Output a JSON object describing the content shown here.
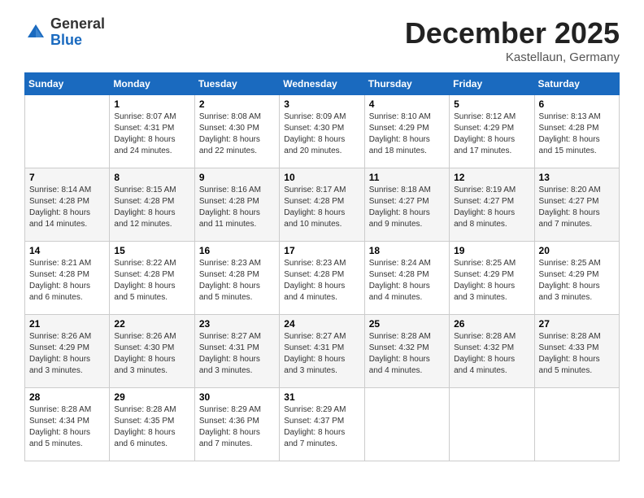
{
  "header": {
    "logo_general": "General",
    "logo_blue": "Blue",
    "month_title": "December 2025",
    "subtitle": "Kastellaun, Germany"
  },
  "calendar": {
    "days_of_week": [
      "Sunday",
      "Monday",
      "Tuesday",
      "Wednesday",
      "Thursday",
      "Friday",
      "Saturday"
    ],
    "weeks": [
      [
        {
          "day": "",
          "info": ""
        },
        {
          "day": "1",
          "info": "Sunrise: 8:07 AM\nSunset: 4:31 PM\nDaylight: 8 hours\nand 24 minutes."
        },
        {
          "day": "2",
          "info": "Sunrise: 8:08 AM\nSunset: 4:30 PM\nDaylight: 8 hours\nand 22 minutes."
        },
        {
          "day": "3",
          "info": "Sunrise: 8:09 AM\nSunset: 4:30 PM\nDaylight: 8 hours\nand 20 minutes."
        },
        {
          "day": "4",
          "info": "Sunrise: 8:10 AM\nSunset: 4:29 PM\nDaylight: 8 hours\nand 18 minutes."
        },
        {
          "day": "5",
          "info": "Sunrise: 8:12 AM\nSunset: 4:29 PM\nDaylight: 8 hours\nand 17 minutes."
        },
        {
          "day": "6",
          "info": "Sunrise: 8:13 AM\nSunset: 4:28 PM\nDaylight: 8 hours\nand 15 minutes."
        }
      ],
      [
        {
          "day": "7",
          "info": "Sunrise: 8:14 AM\nSunset: 4:28 PM\nDaylight: 8 hours\nand 14 minutes."
        },
        {
          "day": "8",
          "info": "Sunrise: 8:15 AM\nSunset: 4:28 PM\nDaylight: 8 hours\nand 12 minutes."
        },
        {
          "day": "9",
          "info": "Sunrise: 8:16 AM\nSunset: 4:28 PM\nDaylight: 8 hours\nand 11 minutes."
        },
        {
          "day": "10",
          "info": "Sunrise: 8:17 AM\nSunset: 4:28 PM\nDaylight: 8 hours\nand 10 minutes."
        },
        {
          "day": "11",
          "info": "Sunrise: 8:18 AM\nSunset: 4:27 PM\nDaylight: 8 hours\nand 9 minutes."
        },
        {
          "day": "12",
          "info": "Sunrise: 8:19 AM\nSunset: 4:27 PM\nDaylight: 8 hours\nand 8 minutes."
        },
        {
          "day": "13",
          "info": "Sunrise: 8:20 AM\nSunset: 4:27 PM\nDaylight: 8 hours\nand 7 minutes."
        }
      ],
      [
        {
          "day": "14",
          "info": "Sunrise: 8:21 AM\nSunset: 4:28 PM\nDaylight: 8 hours\nand 6 minutes."
        },
        {
          "day": "15",
          "info": "Sunrise: 8:22 AM\nSunset: 4:28 PM\nDaylight: 8 hours\nand 5 minutes."
        },
        {
          "day": "16",
          "info": "Sunrise: 8:23 AM\nSunset: 4:28 PM\nDaylight: 8 hours\nand 5 minutes."
        },
        {
          "day": "17",
          "info": "Sunrise: 8:23 AM\nSunset: 4:28 PM\nDaylight: 8 hours\nand 4 minutes."
        },
        {
          "day": "18",
          "info": "Sunrise: 8:24 AM\nSunset: 4:28 PM\nDaylight: 8 hours\nand 4 minutes."
        },
        {
          "day": "19",
          "info": "Sunrise: 8:25 AM\nSunset: 4:29 PM\nDaylight: 8 hours\nand 3 minutes."
        },
        {
          "day": "20",
          "info": "Sunrise: 8:25 AM\nSunset: 4:29 PM\nDaylight: 8 hours\nand 3 minutes."
        }
      ],
      [
        {
          "day": "21",
          "info": "Sunrise: 8:26 AM\nSunset: 4:29 PM\nDaylight: 8 hours\nand 3 minutes."
        },
        {
          "day": "22",
          "info": "Sunrise: 8:26 AM\nSunset: 4:30 PM\nDaylight: 8 hours\nand 3 minutes."
        },
        {
          "day": "23",
          "info": "Sunrise: 8:27 AM\nSunset: 4:31 PM\nDaylight: 8 hours\nand 3 minutes."
        },
        {
          "day": "24",
          "info": "Sunrise: 8:27 AM\nSunset: 4:31 PM\nDaylight: 8 hours\nand 3 minutes."
        },
        {
          "day": "25",
          "info": "Sunrise: 8:28 AM\nSunset: 4:32 PM\nDaylight: 8 hours\nand 4 minutes."
        },
        {
          "day": "26",
          "info": "Sunrise: 8:28 AM\nSunset: 4:32 PM\nDaylight: 8 hours\nand 4 minutes."
        },
        {
          "day": "27",
          "info": "Sunrise: 8:28 AM\nSunset: 4:33 PM\nDaylight: 8 hours\nand 5 minutes."
        }
      ],
      [
        {
          "day": "28",
          "info": "Sunrise: 8:28 AM\nSunset: 4:34 PM\nDaylight: 8 hours\nand 5 minutes."
        },
        {
          "day": "29",
          "info": "Sunrise: 8:28 AM\nSunset: 4:35 PM\nDaylight: 8 hours\nand 6 minutes."
        },
        {
          "day": "30",
          "info": "Sunrise: 8:29 AM\nSunset: 4:36 PM\nDaylight: 8 hours\nand 7 minutes."
        },
        {
          "day": "31",
          "info": "Sunrise: 8:29 AM\nSunset: 4:37 PM\nDaylight: 8 hours\nand 7 minutes."
        },
        {
          "day": "",
          "info": ""
        },
        {
          "day": "",
          "info": ""
        },
        {
          "day": "",
          "info": ""
        }
      ]
    ]
  }
}
